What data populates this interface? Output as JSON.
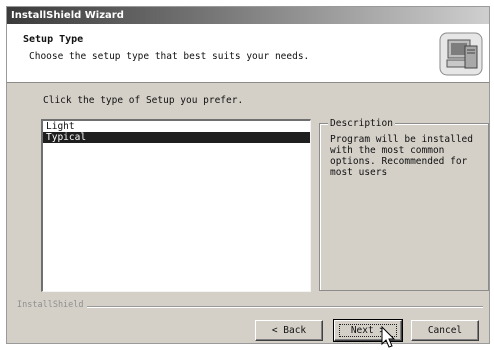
{
  "window": {
    "title": "InstallShield Wizard"
  },
  "header": {
    "title": "Setup Type",
    "subtitle": "Choose the setup type that best suits your needs.",
    "icon": "setup-computer-icon"
  },
  "main": {
    "prompt": "Click the type of Setup you prefer.",
    "setup_types": [
      {
        "label": "Light",
        "selected": false
      },
      {
        "label": "Typical",
        "selected": true
      }
    ],
    "description": {
      "legend": "Description",
      "text": "Program will be installed with the most common options. Recommended for most users"
    }
  },
  "footer": {
    "brand": "InstallShield",
    "back_label": "< Back",
    "next_label": "Next >",
    "cancel_label": "Cancel"
  },
  "colors": {
    "selection": "#1e1e1e",
    "dialog_face": "#d4d0c8"
  }
}
